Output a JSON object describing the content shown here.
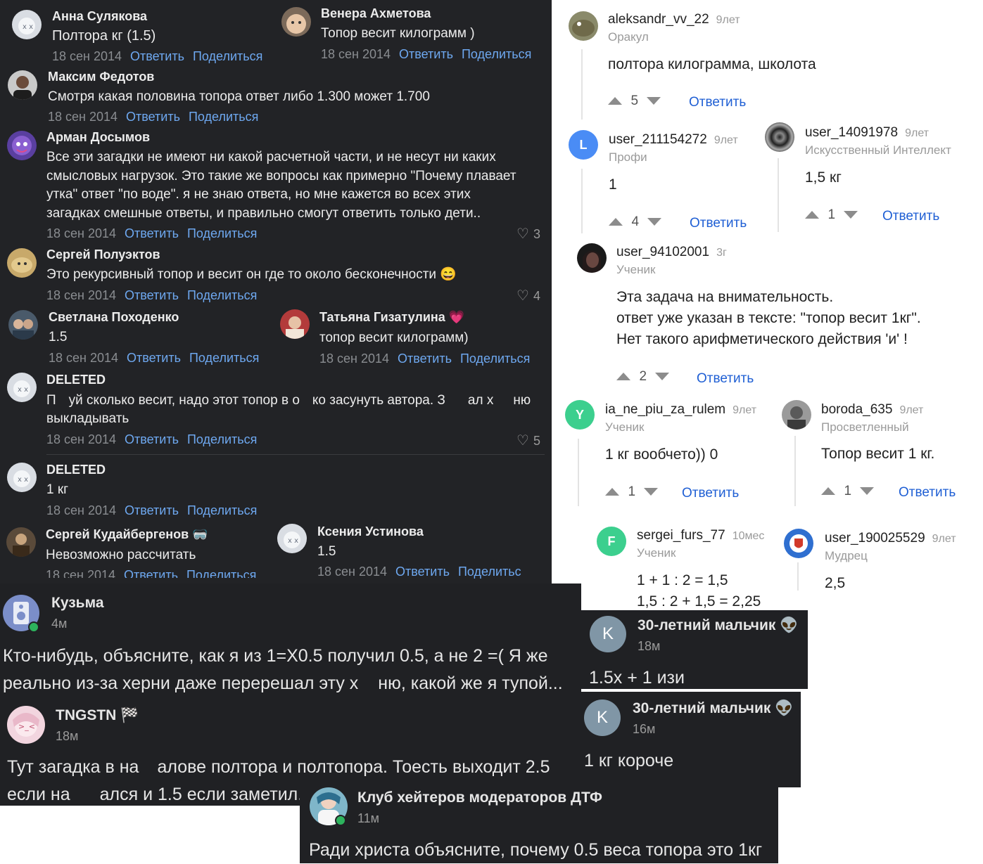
{
  "vk": {
    "meta_date": "18 сен 2014",
    "reply_label": "Ответить",
    "share_label": "Поделиться",
    "share_label_cut1": "Поделиться",
    "share_label_cut2": "Поделитьс",
    "comments": {
      "anna": {
        "name": "Анна Сулякова",
        "text": "Полтора кг (1.5)"
      },
      "venera": {
        "name": "Венера Ахметова",
        "text": "Топор весит килограмм )"
      },
      "maxim": {
        "name": "Максим Федотов",
        "text": "Смотря какая половина топора ответ либо 1.300 может 1.700"
      },
      "arman": {
        "name": "Арман Досымов",
        "lines": [
          "Все эти загадки не имеют ни какой расчетной части, и не несут ни каких",
          "смысловых нагрузок. Это такие же вопросы как примерно \"Почему плавает",
          "утка\" ответ \"по воде\". я не знаю ответа, но мне кажется во всех этих",
          "загадках смешные ответы, и правильно смогут ответить только дети.."
        ],
        "likes": "3"
      },
      "sergey_p": {
        "name": "Сергей Полуэктов",
        "text": "Это рекурсивный топор и весит он где то около бесконечности",
        "emoji": "😄",
        "likes": "4"
      },
      "svetlana": {
        "name": "Светлана Походенко",
        "text": "1.5"
      },
      "tatyana": {
        "name": "Татьяна Гизатулина",
        "text": "топор весит килограмм)",
        "badge": "💗"
      },
      "deleted1": {
        "name": "DELETED",
        "lines_a": [
          "П",
          "уй сколько весит, надо этот топор в о",
          "ко засунуть автора. З",
          "ал х",
          "ню"
        ],
        "line2": "выкладывать",
        "likes": "5"
      },
      "deleted2": {
        "name": "DELETED",
        "text": "1 кг"
      },
      "sergey_k": {
        "name": "Сергей Кудайбергенов",
        "text": "Невозможно рассчитать",
        "badge": "🥽"
      },
      "ksenia": {
        "name": "Ксения Устинова",
        "text": "1.5"
      }
    }
  },
  "answers": {
    "aleksandr": {
      "name": "aleksandr_vv_22",
      "age": "9лет",
      "rank": "Оракул",
      "text": "полтора килограмма, школота",
      "votes": "5",
      "reply": "Ответить"
    },
    "u211": {
      "name": "user_211154272",
      "age": "9лет",
      "rank": "Профи",
      "text": "1",
      "votes": "4",
      "reply": "Ответить",
      "initial": "L"
    },
    "u140": {
      "name": "user_14091978",
      "age": "9лет",
      "rank": "Искусственный Интеллект",
      "text": "1,5 кг",
      "votes": "1",
      "reply": "Ответить"
    },
    "u941": {
      "name": "user_94102001",
      "age": "3г",
      "rank": "Ученик",
      "lines": [
        "Эта задача на внимательность.",
        "ответ уже указан в тексте: \"топор весит 1кг\".",
        "Нет такого арифметического действия 'и' !"
      ],
      "votes": "2",
      "reply": "Ответить"
    },
    "ia": {
      "name": "ia_ne_piu_za_rulem",
      "age": "9лет",
      "rank": "Ученик",
      "text": "1 кг вообчето)) 0",
      "votes": "1",
      "reply": "Ответить",
      "initial": "Y"
    },
    "boroda": {
      "name": "boroda_635",
      "age": "9лет",
      "rank": "Просветленный",
      "text": "Топор весит 1 кг.",
      "votes": "1",
      "reply": "Ответить"
    },
    "sergei": {
      "name": "sergei_furs_77",
      "age": "10мес",
      "rank": "Ученик",
      "lines": [
        "1 + 1 : 2 = 1,5",
        "1,5 : 2 + 1,5 = 2,25"
      ],
      "initial": "F"
    },
    "u190": {
      "name": "user_190025529",
      "age": "9лет",
      "rank": "Мудрец",
      "text": "2,5"
    }
  },
  "dtf": {
    "kuzma": {
      "name": "Кузьма",
      "time": "4м",
      "line1": "Кто-нибудь, объясните, как я из 1=X0.5 получил 0.5, а не 2 =( Я же",
      "line2a": "реально из-за херни даже перерешал эту х",
      "line2b": "ню, какой же я тупой..."
    },
    "boy1": {
      "name": "30-летний мальчик",
      "time": "18м",
      "text": "1.5х + 1 изи",
      "initial": "K",
      "badge": "👽"
    },
    "boy2": {
      "name": "30-летний мальчик",
      "time": "16м",
      "text": "1 кг короче",
      "initial": "K",
      "badge": "👽"
    },
    "tngstn": {
      "name": "TNGSTN",
      "time": "18м",
      "badge": "🏁",
      "line1a": "Тут загадка в на",
      "line1b": "алове полтора и полтопора. Тоесть выходит 2.5",
      "line2a": "если на",
      "line2b": "ался и 1.5 если заметил."
    },
    "club": {
      "name": "Клуб хейтеров модераторов ДТФ",
      "time": "11м",
      "text": "Ради христа объясните, почему 0.5 веса топора это 1кг"
    }
  }
}
